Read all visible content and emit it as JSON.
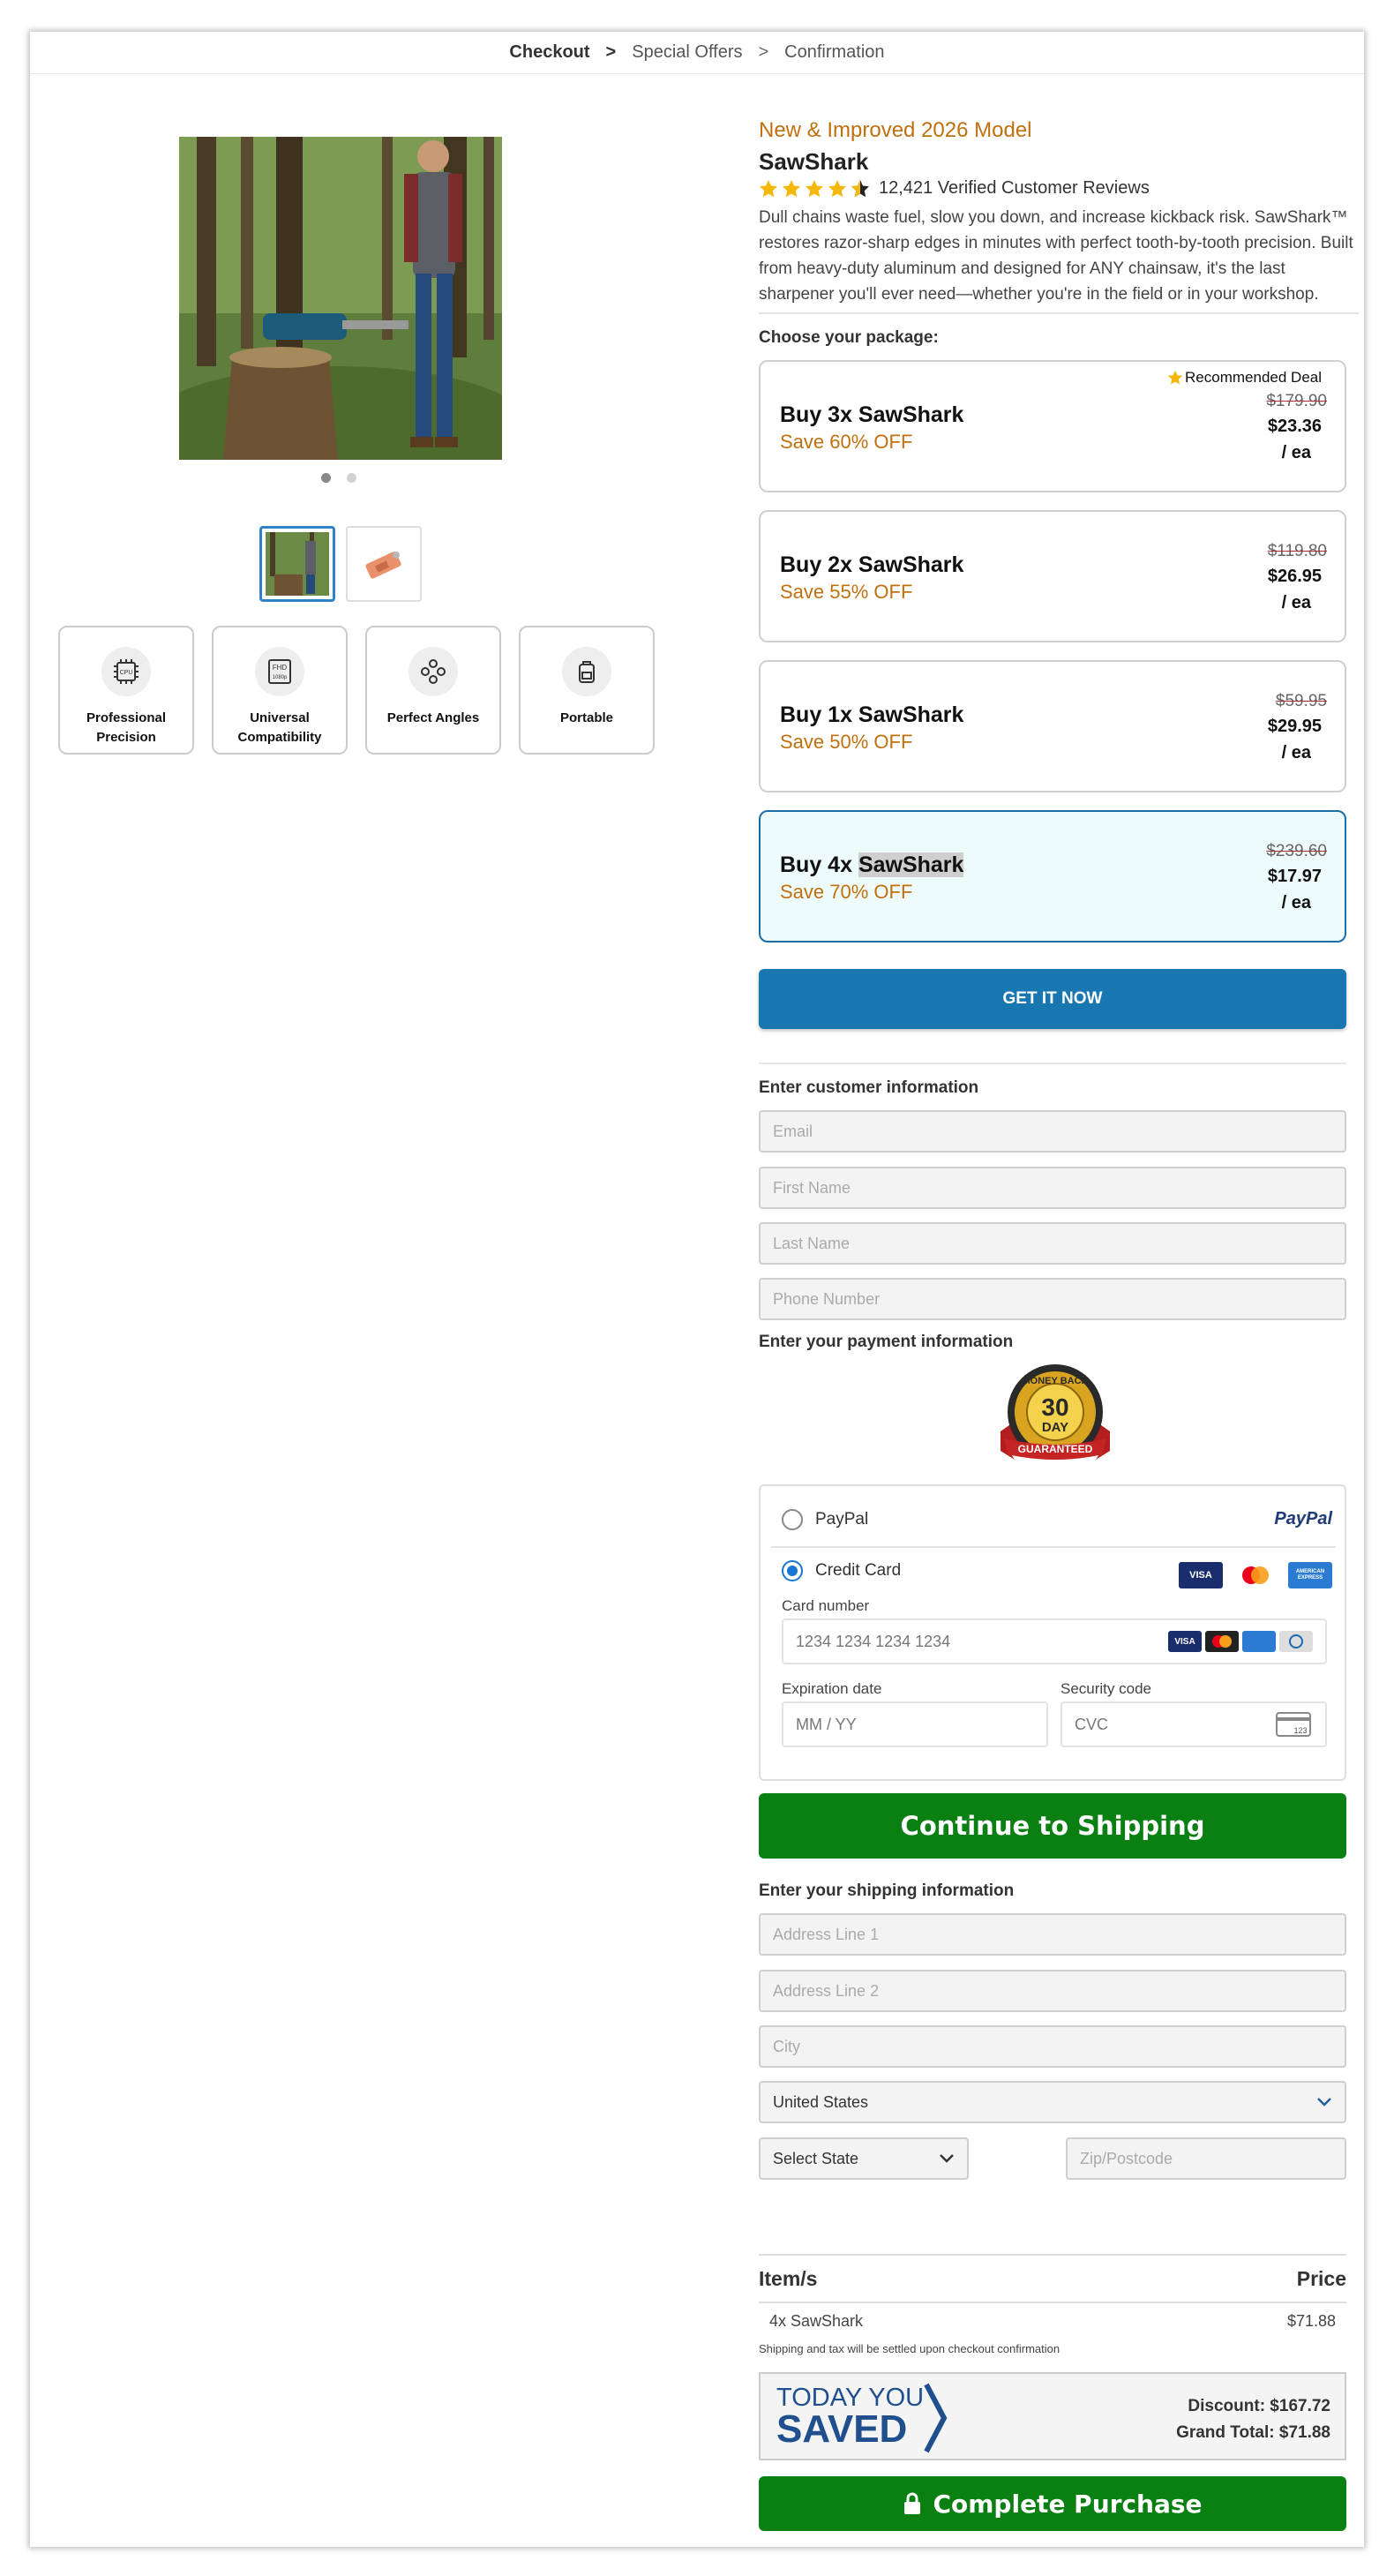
{
  "breadcrumb": {
    "step1": "Checkout",
    "sep": ">",
    "step2": "Special Offers",
    "step3": "Confirmation"
  },
  "product": {
    "badge": "New & Improved 2026 Model",
    "name": "SawShark",
    "rating_text": "12,421 Verified Customer Reviews",
    "description": "Dull chains waste fuel, slow you down, and increase kickback risk. SawShark™ restores razor-sharp edges in minutes with perfect tooth-by-tooth precision. Built from heavy-duty aluminum and designed for ANY chainsaw, it's the last sharpener you'll ever need—whether you're in the field or in your workshop."
  },
  "features": [
    {
      "label": "Professional Precision",
      "icon": "cpu-icon"
    },
    {
      "label": "Universal Compatibility",
      "icon": "fhd-1080p-icon"
    },
    {
      "label": "Perfect Angles",
      "icon": "nodes-icon"
    },
    {
      "label": "Portable",
      "icon": "backpack-icon"
    }
  ],
  "packages": {
    "heading": "Choose your package:",
    "items": [
      {
        "title": "Buy 3x SawShark",
        "save": "Save 60% OFF",
        "old": "$179.90",
        "price": "$23.36",
        "unit": "/ ea",
        "tag": "Recommended Deal"
      },
      {
        "title": "Buy 2x SawShark",
        "save": "Save 55% OFF",
        "old": "$119.80",
        "price": "$26.95",
        "unit": "/ ea"
      },
      {
        "title": "Buy 1x SawShark",
        "save": "Save 50% OFF",
        "old": "$59.95",
        "price": "$29.95",
        "unit": "/ ea"
      },
      {
        "title_prefix": "Buy 4x",
        "title_hl": "SawShark",
        "save": "Save 70% OFF",
        "old": "$239.60",
        "price": "$17.97",
        "unit": "/ ea"
      }
    ]
  },
  "cta_get": "GET IT NOW",
  "customer": {
    "heading": "Enter customer information",
    "email": "Email",
    "first": "First Name",
    "last": "Last Name",
    "phone": "Phone Number"
  },
  "payment": {
    "heading": "Enter your payment information",
    "guarantee_top": "MONEY BACK",
    "guarantee_num": "30",
    "guarantee_day": "DAY",
    "guarantee_bottom": "GUARANTEED",
    "paypal_label": "PayPal",
    "paypal_logo": "PayPal",
    "cc_label": "Credit Card",
    "card_number_label": "Card number",
    "card_number_ph": "1234 1234 1234 1234",
    "exp_label": "Expiration date",
    "exp_ph": "MM / YY",
    "cvc_label": "Security code",
    "cvc_ph": "CVC",
    "cvc_icon_text": "123",
    "visa": "VISA",
    "amex": "AMERICAN EXPRESS"
  },
  "cta_shipping": "Continue to Shipping",
  "shipping": {
    "heading": "Enter your shipping information",
    "addr1": "Address Line 1",
    "addr2": "Address Line 2",
    "city": "City",
    "country": "United States",
    "state": "Select State",
    "zip": "Zip/Postcode"
  },
  "summary": {
    "col_item": "Item/s",
    "col_price": "Price",
    "item": "4x SawShark",
    "item_price": "$71.88",
    "note": "Shipping and tax will be settled upon checkout confirmation",
    "today": "TODAY YOU",
    "saved": "SAVED",
    "discount": "Discount: $167.72",
    "grand": "Grand Total: $71.88"
  },
  "cta_complete": "Complete Purchase",
  "colors": {
    "brand_blue": "#1877b0",
    "green": "#0a7f12",
    "accent_orange": "#c0700f"
  }
}
